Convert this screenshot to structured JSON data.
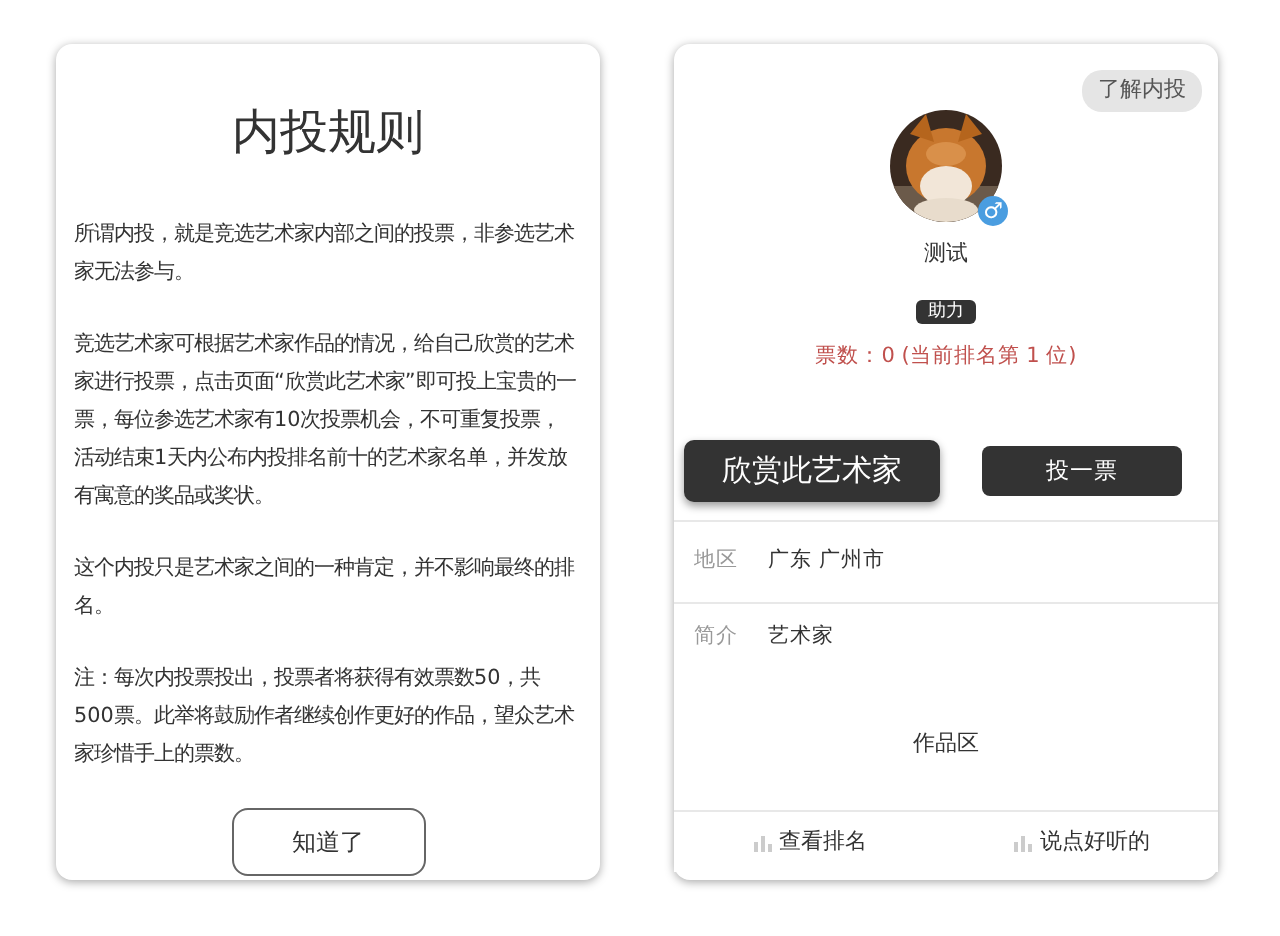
{
  "rules_dialog": {
    "title": "内投规则",
    "paragraphs": [
      "所谓内投，就是竞选艺术家内部之间的投票，非参选艺术家无法参与。",
      "竞选艺术家可根据艺术家作品的情况，给自己欣赏的艺术家进行投票，点击页面“欣赏此艺术家”即可投上宝贵的一票，每位参选艺术家有10次投票机会，不可重复投票，活动结束1天内公布内投排名前十的艺术家名单，并发放有寓意的奖品或奖状。",
      "这个内投只是艺术家之间的一种肯定，并不影响最终的排名。",
      "注：每次内投票投出，投票者将获得有效票数50，共500票。此举将鼓励作者继续创作更好的作品，望众艺术家珍惜手上的票数。"
    ],
    "button": "知道了"
  },
  "profile": {
    "about_button": "了解内投",
    "gender_icon": "♂",
    "name": "测试",
    "tag": "助力",
    "votes": "票数：0 (当前排名第 1 位)",
    "buttons": [
      "欣赏此艺术家",
      "投一票"
    ],
    "fields": [
      {
        "label": "地区",
        "value": "广东 广州市"
      },
      {
        "label": "简介",
        "value": "艺术家"
      }
    ],
    "works_label": "作品区",
    "footer_tabs": [
      "查看排名",
      "说点好听的"
    ]
  }
}
